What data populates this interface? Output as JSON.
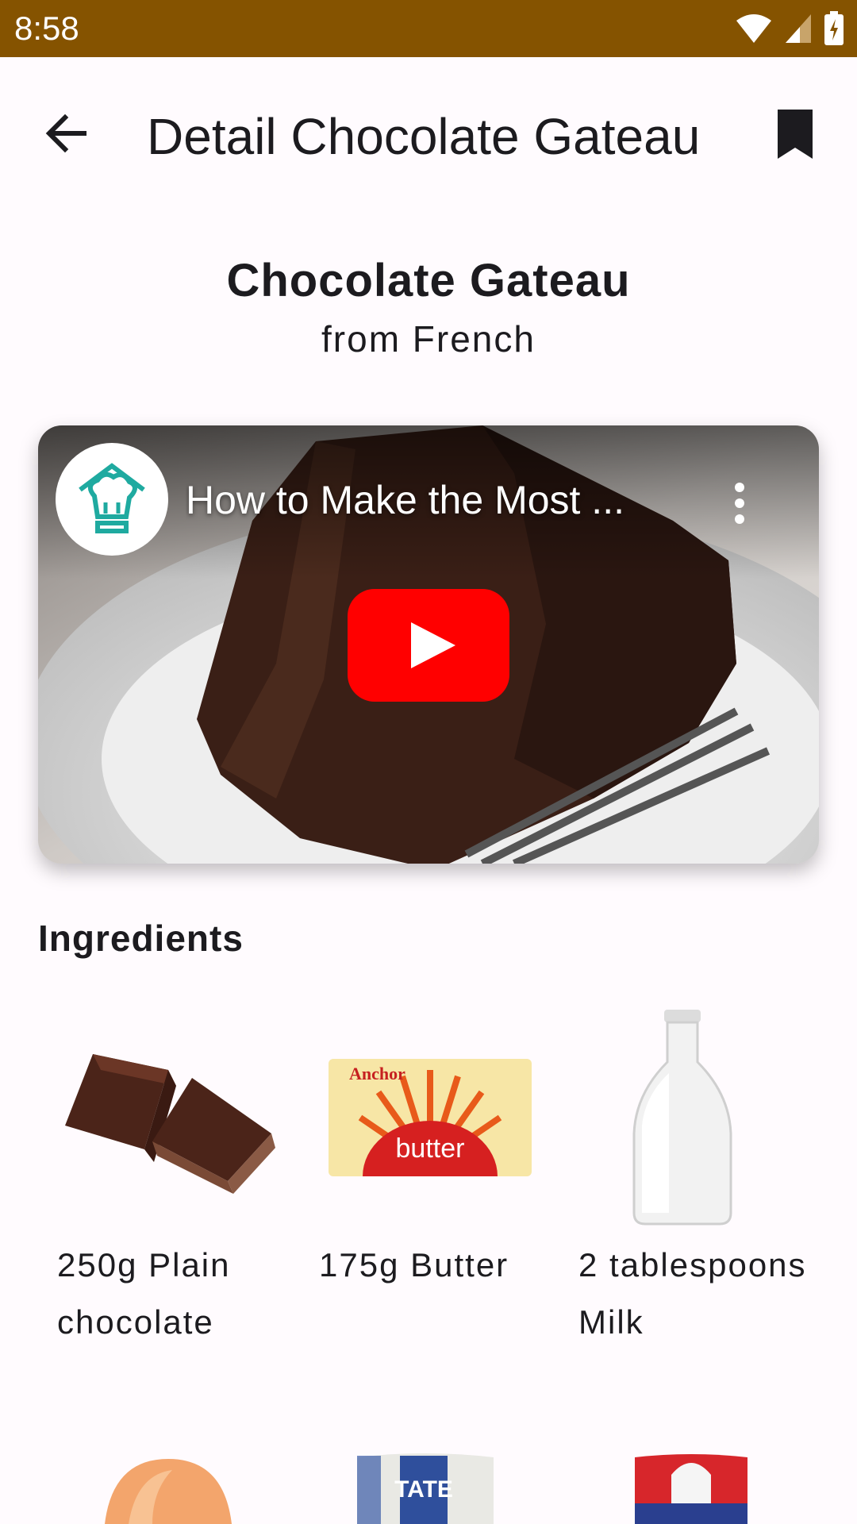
{
  "status_bar": {
    "time": "8:58"
  },
  "app_bar": {
    "title": "Detail Chocolate Gateau"
  },
  "recipe": {
    "name": "Chocolate Gateau",
    "origin": "from French"
  },
  "video": {
    "title": "How to Make the Most ..."
  },
  "ingredients": {
    "heading": "Ingredients",
    "items": [
      {
        "label": "250g Plain chocolate"
      },
      {
        "label": "175g Butter"
      },
      {
        "label": "2 tablespoons Milk"
      }
    ]
  },
  "colors": {
    "status_bar": "#855300",
    "youtube_red": "#ff0000",
    "channel_teal": "#1faaa0"
  }
}
